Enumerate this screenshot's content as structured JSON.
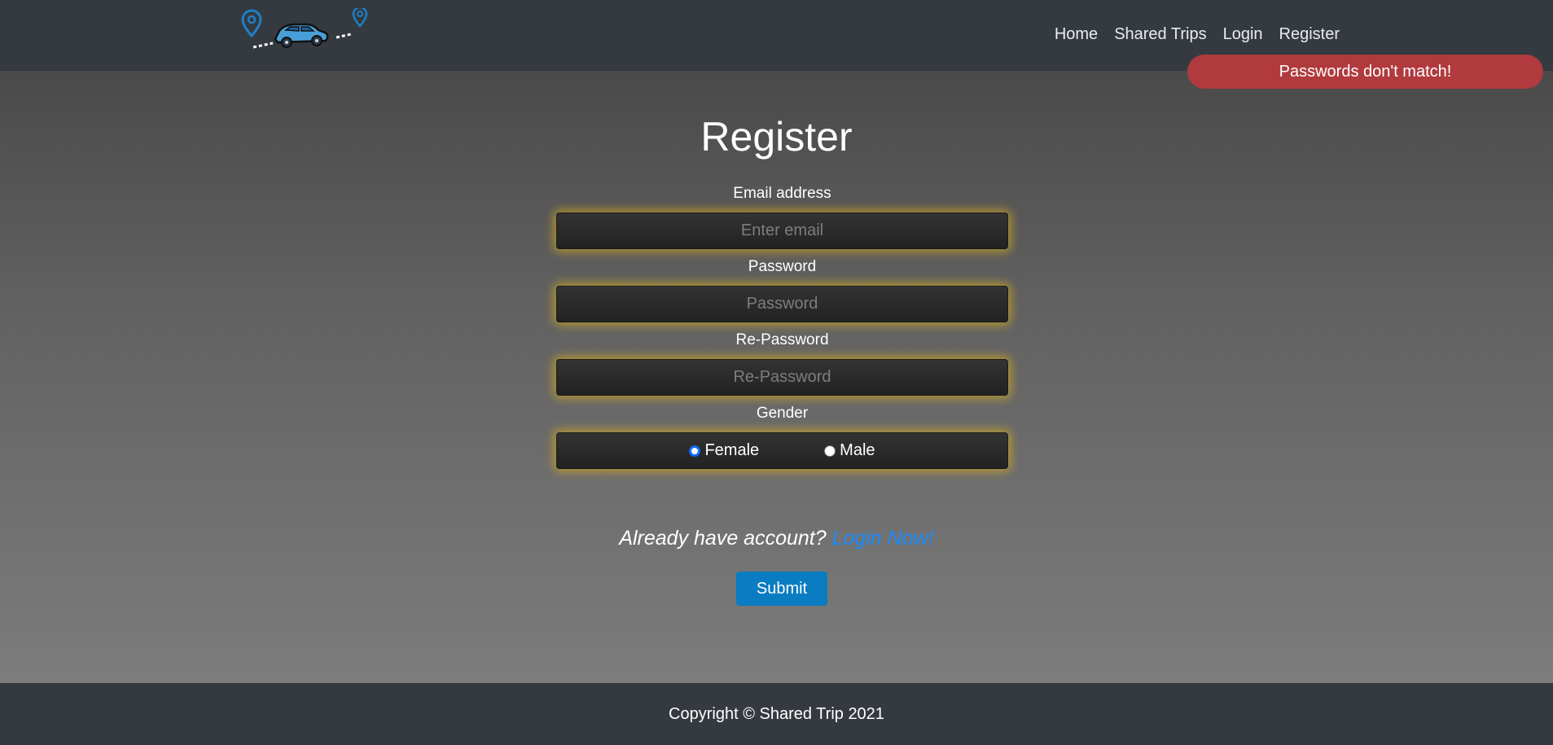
{
  "navbar": {
    "logo_icon": "car-trip-route-logo",
    "links": [
      {
        "label": "Home"
      },
      {
        "label": "Shared Trips"
      },
      {
        "label": "Login"
      },
      {
        "label": "Register"
      }
    ]
  },
  "alert": {
    "message": "Passwords don't match!",
    "color": "#b03a3d"
  },
  "page": {
    "title": "Register"
  },
  "form": {
    "email": {
      "label": "Email address",
      "placeholder": "Enter email",
      "value": ""
    },
    "password": {
      "label": "Password",
      "placeholder": "Password",
      "value": ""
    },
    "repassword": {
      "label": "Re-Password",
      "placeholder": "Re-Password",
      "value": ""
    },
    "gender": {
      "label": "Gender",
      "options": [
        {
          "label": "Female",
          "checked": true
        },
        {
          "label": "Male",
          "checked": false
        }
      ]
    },
    "already_text": "Already have account?",
    "login_link": "Login Now!",
    "submit_label": "Submit"
  },
  "footer": {
    "copyright": "Copyright © Shared Trip 2021"
  },
  "colors": {
    "navbar": "#343a40",
    "accent": "#0a7cc1",
    "glow": "#d4aa1e",
    "link": "#1a8cff"
  }
}
